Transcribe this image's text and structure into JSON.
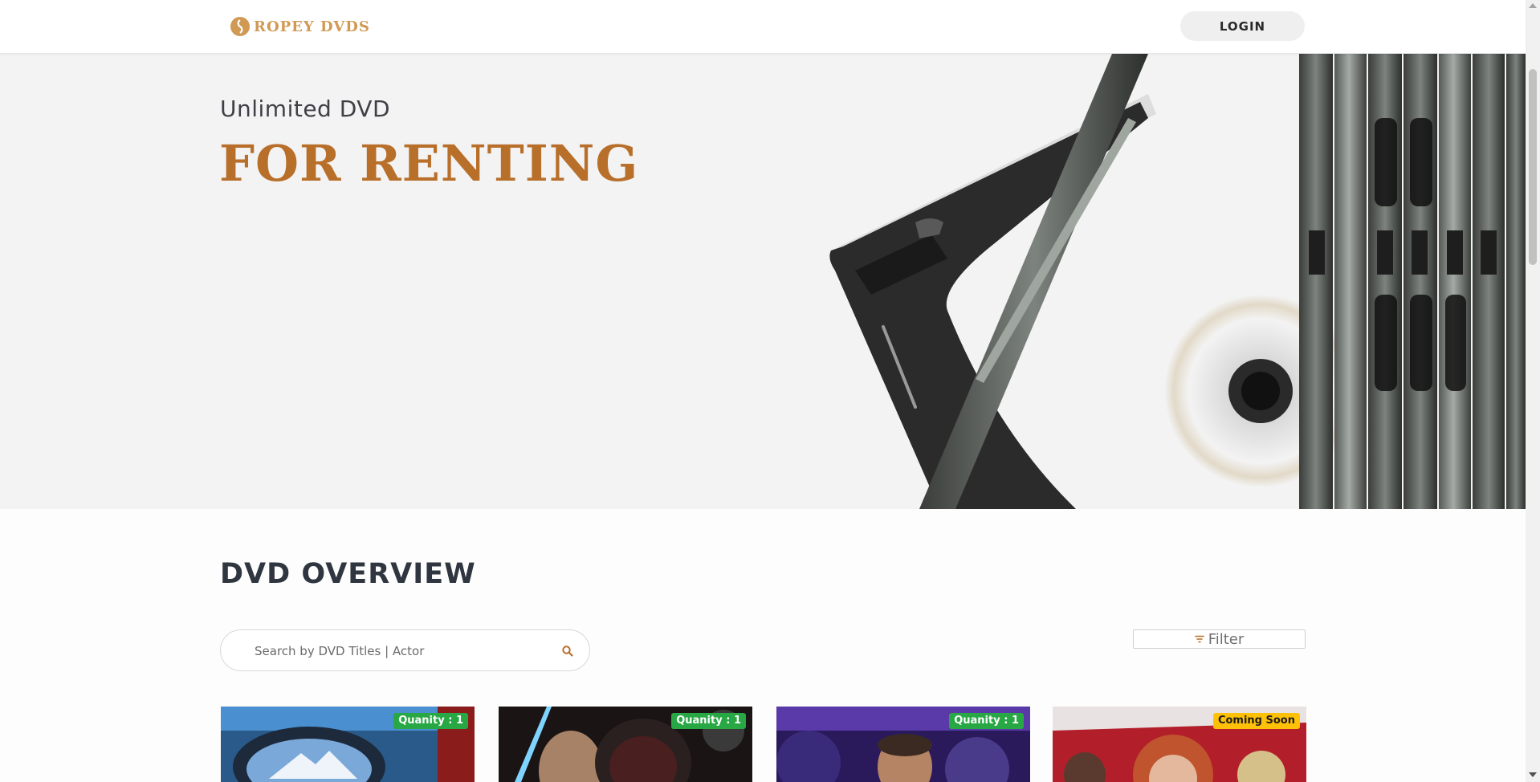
{
  "header": {
    "logo_text": "ROPEY DVDS",
    "login_label": "LOGIN"
  },
  "hero": {
    "subtitle": "Unlimited DVD",
    "title": "FOR RENTING"
  },
  "overview": {
    "title": "DVD OVERVIEW",
    "search_placeholder": "Search by DVD Titles | Actor",
    "filter_label": "Filter"
  },
  "cards": [
    {
      "badge": "Quanity : 1",
      "status": "available"
    },
    {
      "badge": "Quanity : 1",
      "status": "available"
    },
    {
      "badge": "Quanity : 1",
      "status": "available"
    },
    {
      "badge": "Coming Soon",
      "status": "coming-soon"
    }
  ],
  "colors": {
    "brand": "#b86f2a",
    "logo": "#d09a55",
    "badge_available": "#28a745",
    "badge_coming_soon": "#ffc107"
  }
}
